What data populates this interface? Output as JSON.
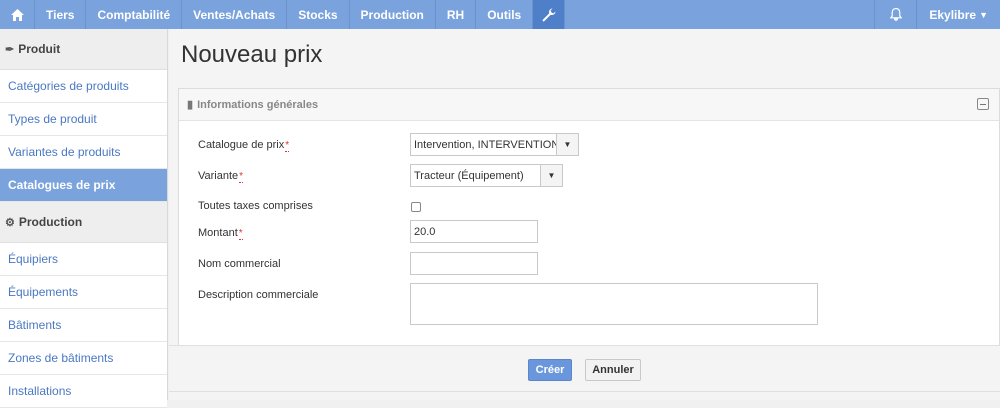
{
  "nav": {
    "items": [
      "Tiers",
      "Comptabilité",
      "Ventes/Achats",
      "Stocks",
      "Production",
      "RH",
      "Outils"
    ],
    "user": "Ekylibre"
  },
  "sidebar": {
    "sections": [
      {
        "title": "Produit",
        "icon": "feather-icon",
        "items": [
          {
            "label": "Catégories de produits"
          },
          {
            "label": "Types de produit"
          },
          {
            "label": "Variantes de produits"
          },
          {
            "label": "Catalogues de prix",
            "active": true
          }
        ]
      },
      {
        "title": "Production",
        "icon": "gears-icon",
        "items": [
          {
            "label": "Équipiers"
          },
          {
            "label": "Équipements"
          },
          {
            "label": "Bâtiments"
          },
          {
            "label": "Zones de bâtiments"
          },
          {
            "label": "Installations"
          }
        ]
      }
    ]
  },
  "page": {
    "title": "Nouveau prix"
  },
  "panel": {
    "title": "Informations générales",
    "fields": {
      "catalogue": {
        "label": "Catalogue de prix",
        "required_mark": "*",
        "value": "Intervention, INTERVENTION"
      },
      "variante": {
        "label": "Variante",
        "required_mark": "*",
        "value": "Tracteur (Équipement)"
      },
      "ttc": {
        "label": "Toutes taxes comprises",
        "checked": false
      },
      "montant": {
        "label": "Montant",
        "required_mark": "*",
        "value": "20.0"
      },
      "nom": {
        "label": "Nom commercial",
        "value": ""
      },
      "description": {
        "label": "Description commerciale",
        "value": ""
      }
    }
  },
  "actions": {
    "create": "Créer",
    "cancel": "Annuler"
  },
  "colors": {
    "nav_bg": "#7aa2dd",
    "active_bg": "#7aa2dd",
    "link": "#4a78c2",
    "primary_button": "#6a97dc"
  }
}
